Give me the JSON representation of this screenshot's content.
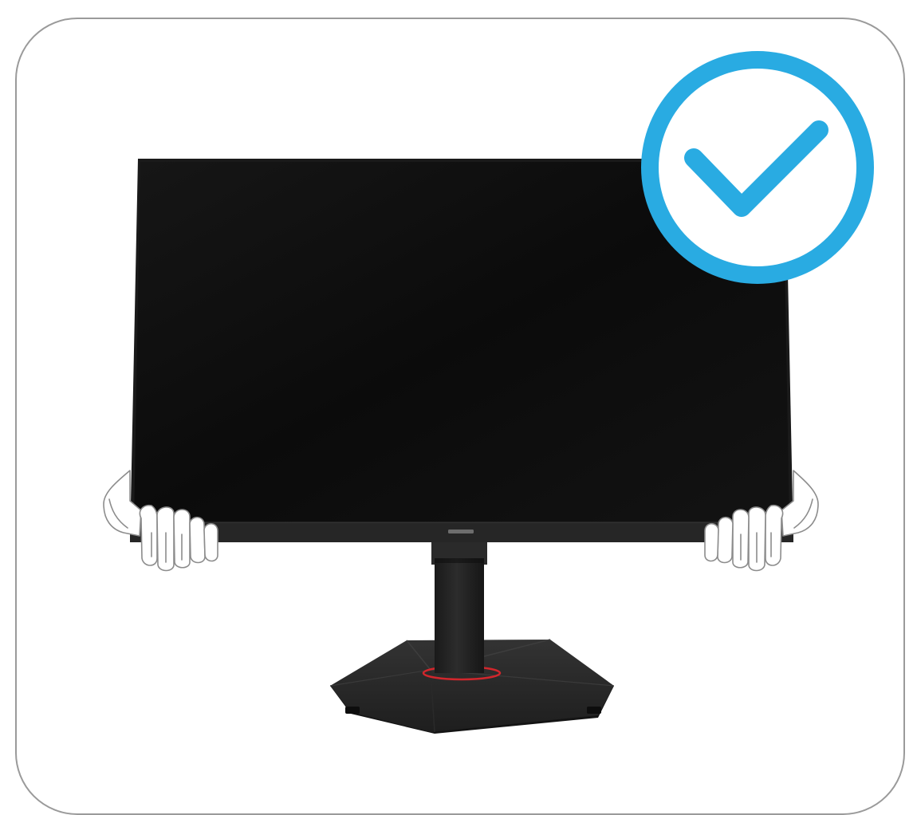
{
  "illustration": {
    "monitor": {
      "brand_label": "",
      "screen_color": "#0a0a0a",
      "accent_ring_color": "#d1262c"
    },
    "approval_badge": {
      "icon": "checkmark-icon",
      "color": "#29abe2"
    },
    "hands": {
      "outline_color": "#8c8c8c"
    }
  }
}
